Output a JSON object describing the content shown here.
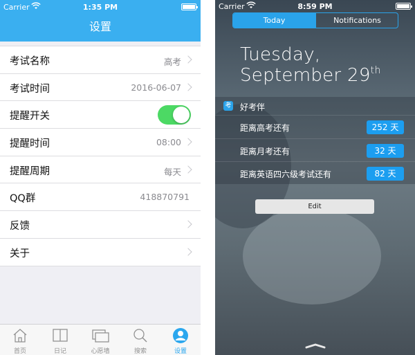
{
  "left": {
    "status": {
      "carrier": "Carrier",
      "time": "1:35 PM"
    },
    "title": "设置",
    "rows": [
      {
        "label": "考试名称",
        "value": "高考"
      },
      {
        "label": "考试时间",
        "value": "2016-06-07"
      },
      {
        "label": "提醒开关",
        "value": ""
      },
      {
        "label": "提醒时间",
        "value": "08:00"
      },
      {
        "label": "提醒周期",
        "value": "每天"
      },
      {
        "label": "QQ群",
        "value": "418870791"
      },
      {
        "label": "反馈",
        "value": ""
      },
      {
        "label": "关于",
        "value": ""
      }
    ],
    "toggle_on": true,
    "tabs": [
      {
        "label": "首页",
        "icon": "home-icon"
      },
      {
        "label": "日记",
        "icon": "book-icon"
      },
      {
        "label": "心愿墙",
        "icon": "cards-icon"
      },
      {
        "label": "搜索",
        "icon": "search-icon"
      },
      {
        "label": "设置",
        "icon": "user-icon"
      }
    ],
    "active_tab": 4,
    "colors": {
      "accent": "#3aaff0",
      "toggle": "#4cd964"
    }
  },
  "right": {
    "status": {
      "carrier": "Carrier",
      "time": "8:59 PM"
    },
    "segments": [
      "Today",
      "Notifications"
    ],
    "date_line1": "Tuesday,",
    "date_line2": "September 29",
    "date_suffix": "th",
    "app_icon_glyph": "考",
    "app_name": "好考伴",
    "countdowns": [
      {
        "label": "距离高考还有",
        "days": "252 天"
      },
      {
        "label": "距离月考还有",
        "days": "32 天"
      },
      {
        "label": "距离英语四六级考试还有",
        "days": "82 天"
      }
    ],
    "edit_label": "Edit",
    "colors": {
      "badge": "#1c9ef0"
    }
  }
}
